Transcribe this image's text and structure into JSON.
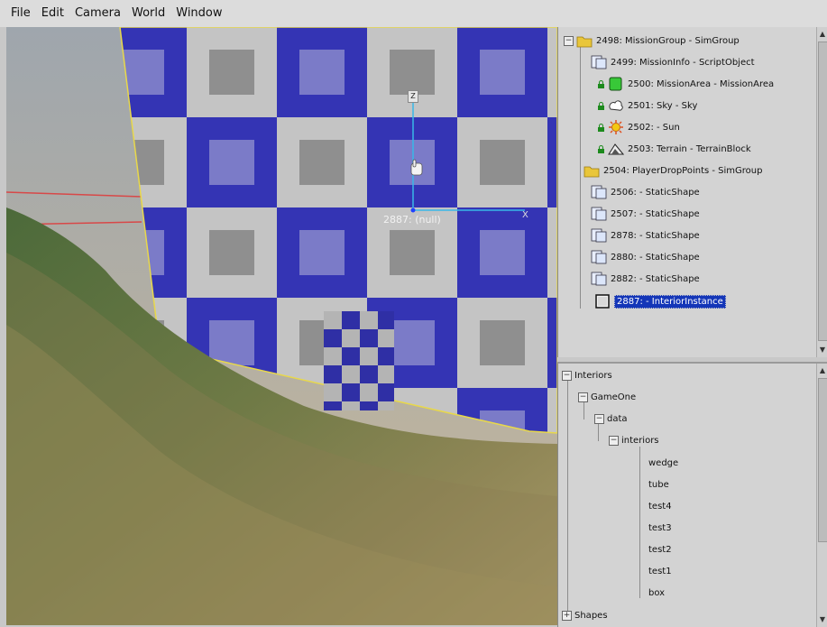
{
  "menu": [
    "File",
    "Edit",
    "Camera",
    "World",
    "Window"
  ],
  "viewport": {
    "selection_label": "2887: (null)",
    "axis_z": "Z",
    "axis_x": "X"
  },
  "mission_tree": [
    {
      "label": "2498: MissionGroup - SimGroup",
      "expander": "⊟"
    },
    {
      "label": "2499: MissionInfo - ScriptObject"
    },
    {
      "label": "2500: MissionArea - MissionArea"
    },
    {
      "label": "2501: Sky - Sky"
    },
    {
      "label": "2502: - Sun"
    },
    {
      "label": "2503: Terrain - TerrainBlock"
    },
    {
      "label": "2504: PlayerDropPoints - SimGroup"
    },
    {
      "label": "2506: - StaticShape"
    },
    {
      "label": "2507: - StaticShape"
    },
    {
      "label": "2878: - StaticShape"
    },
    {
      "label": "2880: - StaticShape"
    },
    {
      "label": "2882: - StaticShape"
    },
    {
      "label": "2887: - InteriorInstance"
    }
  ],
  "file_tree": [
    {
      "label": "Interiors"
    },
    {
      "label": "GameOne"
    },
    {
      "label": "data"
    },
    {
      "label": "interiors"
    },
    {
      "label": "wedge"
    },
    {
      "label": "tube"
    },
    {
      "label": "test4"
    },
    {
      "label": "test3"
    },
    {
      "label": "test2"
    },
    {
      "label": "test1"
    },
    {
      "label": "box"
    },
    {
      "label": "Shapes"
    }
  ],
  "colors": {
    "checker_blue": "#3434b4",
    "checker_gray": "#c4c4c4",
    "selection": "#1436b8",
    "lock_green": "#1c8a1c"
  }
}
